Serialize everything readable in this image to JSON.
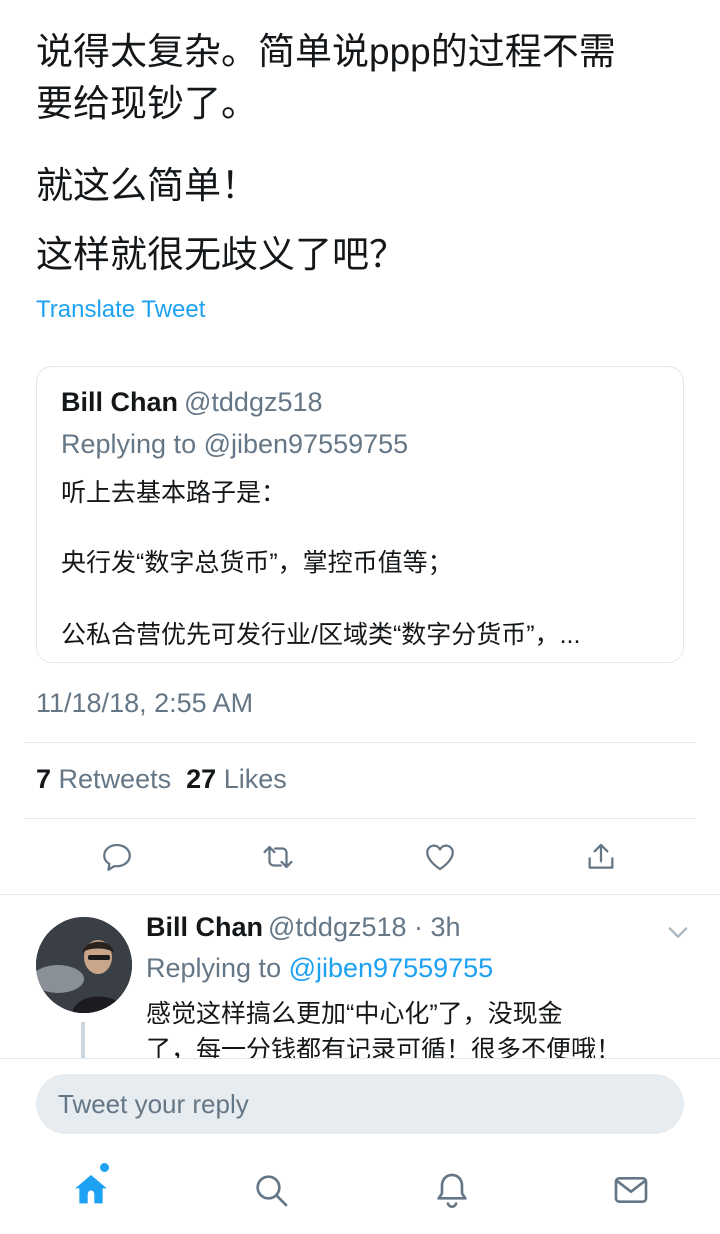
{
  "tweet": {
    "line1": "说得太复杂。简单说ppp的过程不需",
    "line2": "要给现钞了。",
    "para2": "就这么简单！",
    "para3": "这样就很无歧义了吧？",
    "translate_label": "Translate Tweet"
  },
  "quoted": {
    "name": "Bill Chan",
    "handle": "@tddgz518",
    "replying": "Replying to @jiben97559755",
    "line1": "听上去基本路子是：",
    "line2": "央行发“数字总货币”，掌控币值等；",
    "line3": "公私合营优先可发行业/区域类“数字分货币”，..."
  },
  "timestamp": "11/18/18, 2:55 AM",
  "stats": {
    "retweets_count": "7",
    "retweets_label": "Retweets",
    "likes_count": "27",
    "likes_label": "Likes"
  },
  "actions": {
    "reply_icon": "reply-icon",
    "retweet_icon": "retweet-icon",
    "like_icon": "heart-icon",
    "share_icon": "share-icon"
  },
  "reply": {
    "name": "Bill Chan",
    "meta": "@tddgz518 · 3h",
    "replying_prefix": "Replying to ",
    "replying_handle": "@jiben97559755",
    "body_line1": "感觉这样搞么更加“中心化”了，没现金",
    "body_line2": "了，每一分钱都有记录可循！很多不便哦！"
  },
  "composer": {
    "placeholder": "Tweet your reply"
  },
  "nav": {
    "items": [
      "home-icon",
      "search-icon",
      "notifications-icon",
      "messages-icon"
    ]
  },
  "colors": {
    "accent": "#1da1f2",
    "secondary_text": "#657786",
    "divider": "#e1e8ed"
  }
}
